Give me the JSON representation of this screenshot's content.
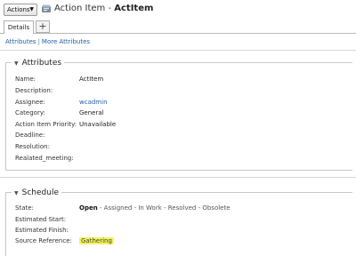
{
  "toolbar": {
    "actions_label": "Actions"
  },
  "header": {
    "type_label": "Action Item",
    "separator": "-",
    "name": "ActItem"
  },
  "tabs": [
    {
      "label": "Details"
    }
  ],
  "tab_add": "+",
  "links": {
    "attributes": "Attributes",
    "separator": "|",
    "more_attributes": "More Attributes"
  },
  "attributes_panel": {
    "title": "Attributes",
    "rows": [
      {
        "label": "Name:",
        "value": "ActItem"
      },
      {
        "label": "Description:",
        "value": ""
      },
      {
        "label": "Assignee:",
        "value": "wcadmin"
      },
      {
        "label": "Category:",
        "value": "General"
      },
      {
        "label": "Action Item Priority:",
        "value": "Unavailable"
      },
      {
        "label": "Deadline:",
        "value": ""
      },
      {
        "label": "Resolution:",
        "value": ""
      },
      {
        "label": "Realated_meeting:",
        "value": ""
      }
    ]
  },
  "schedule_panel": {
    "title": "Schedule",
    "state_label": "State:",
    "state_current": "Open",
    "state_rest": " - Assigned - In Work - Resolved - Obsolete",
    "rows": [
      {
        "label": "Estimated Start:",
        "value": ""
      },
      {
        "label": "Estimated Finish:",
        "value": ""
      },
      {
        "label": "Source Reference:",
        "value": "Gathering"
      }
    ]
  },
  "colors": {
    "link": "#1f5fa8",
    "highlight": "#f4f25a"
  }
}
